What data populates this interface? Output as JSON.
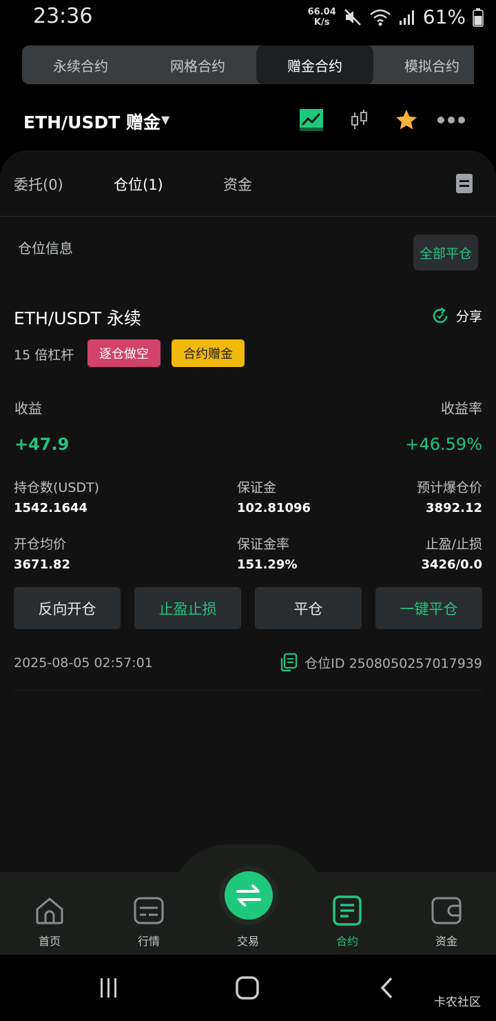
{
  "status_bar": {
    "time": "23:36",
    "net_speed_value": "66.04",
    "net_speed_unit": "K/s",
    "battery": "61%",
    "icons": [
      "mute-icon",
      "wifi-icon",
      "signal-icon",
      "battery-icon"
    ]
  },
  "contract_tabs": [
    {
      "label": "永续合约",
      "active": false
    },
    {
      "label": "网格合约",
      "active": false
    },
    {
      "label": "赠金合约",
      "active": true
    },
    {
      "label": "模拟合约",
      "active": false
    }
  ],
  "pair_header": {
    "title": "ETH/USDT  赠金",
    "icons": [
      "line-chart-icon",
      "candlestick-icon",
      "star-icon",
      "more-icon"
    ]
  },
  "position_tabs": [
    {
      "label": "委托(0)",
      "active": false
    },
    {
      "label": "仓位(1)",
      "active": true
    },
    {
      "label": "资金",
      "active": false
    }
  ],
  "section": {
    "title": "仓位信息",
    "close_all": "全部平仓"
  },
  "position": {
    "name": "ETH/USDT 永续",
    "share": "分享",
    "leverage": "15 倍杠杆",
    "badge_side": "逐仓做空",
    "badge_type": "合约赠金",
    "pnl_label": "收益",
    "pnl_value": "+47.9",
    "roi_label": "收益率",
    "roi_value": "+46.59%",
    "size_label": "持仓数(USDT)",
    "size_value": "1542.1644",
    "margin_label": "保证金",
    "margin_value": "102.81096",
    "liq_label": "预计爆仓价",
    "liq_value": "3892.12",
    "entry_label": "开仓均价",
    "entry_value": "3671.82",
    "margin_ratio_label": "保证金率",
    "margin_ratio_value": "151.29%",
    "tpsl_label": "止盈/止损",
    "tpsl_value": "3426/0.0",
    "timestamp": "2025-08-05 02:57:01",
    "position_id": "仓位ID 2508050257017939"
  },
  "actions": [
    {
      "label": "反向开仓",
      "accent": false
    },
    {
      "label": "止盈止损",
      "accent": true
    },
    {
      "label": "平仓",
      "accent": false
    },
    {
      "label": "一键平仓",
      "accent": true
    }
  ],
  "bottom_nav": [
    {
      "label": "首页",
      "icon": "home-icon"
    },
    {
      "label": "行情",
      "icon": "market-icon"
    },
    {
      "label": "交易",
      "icon": "swap-icon"
    },
    {
      "label": "合约",
      "icon": "contract-icon",
      "active": true
    },
    {
      "label": "资金",
      "icon": "wallet-icon"
    }
  ],
  "watermark": "卡农社区",
  "colors": {
    "accent": "#23c47e",
    "short_badge": "#d2426a",
    "bonus_badge": "#f0b90b",
    "star": "#f7b23b"
  }
}
